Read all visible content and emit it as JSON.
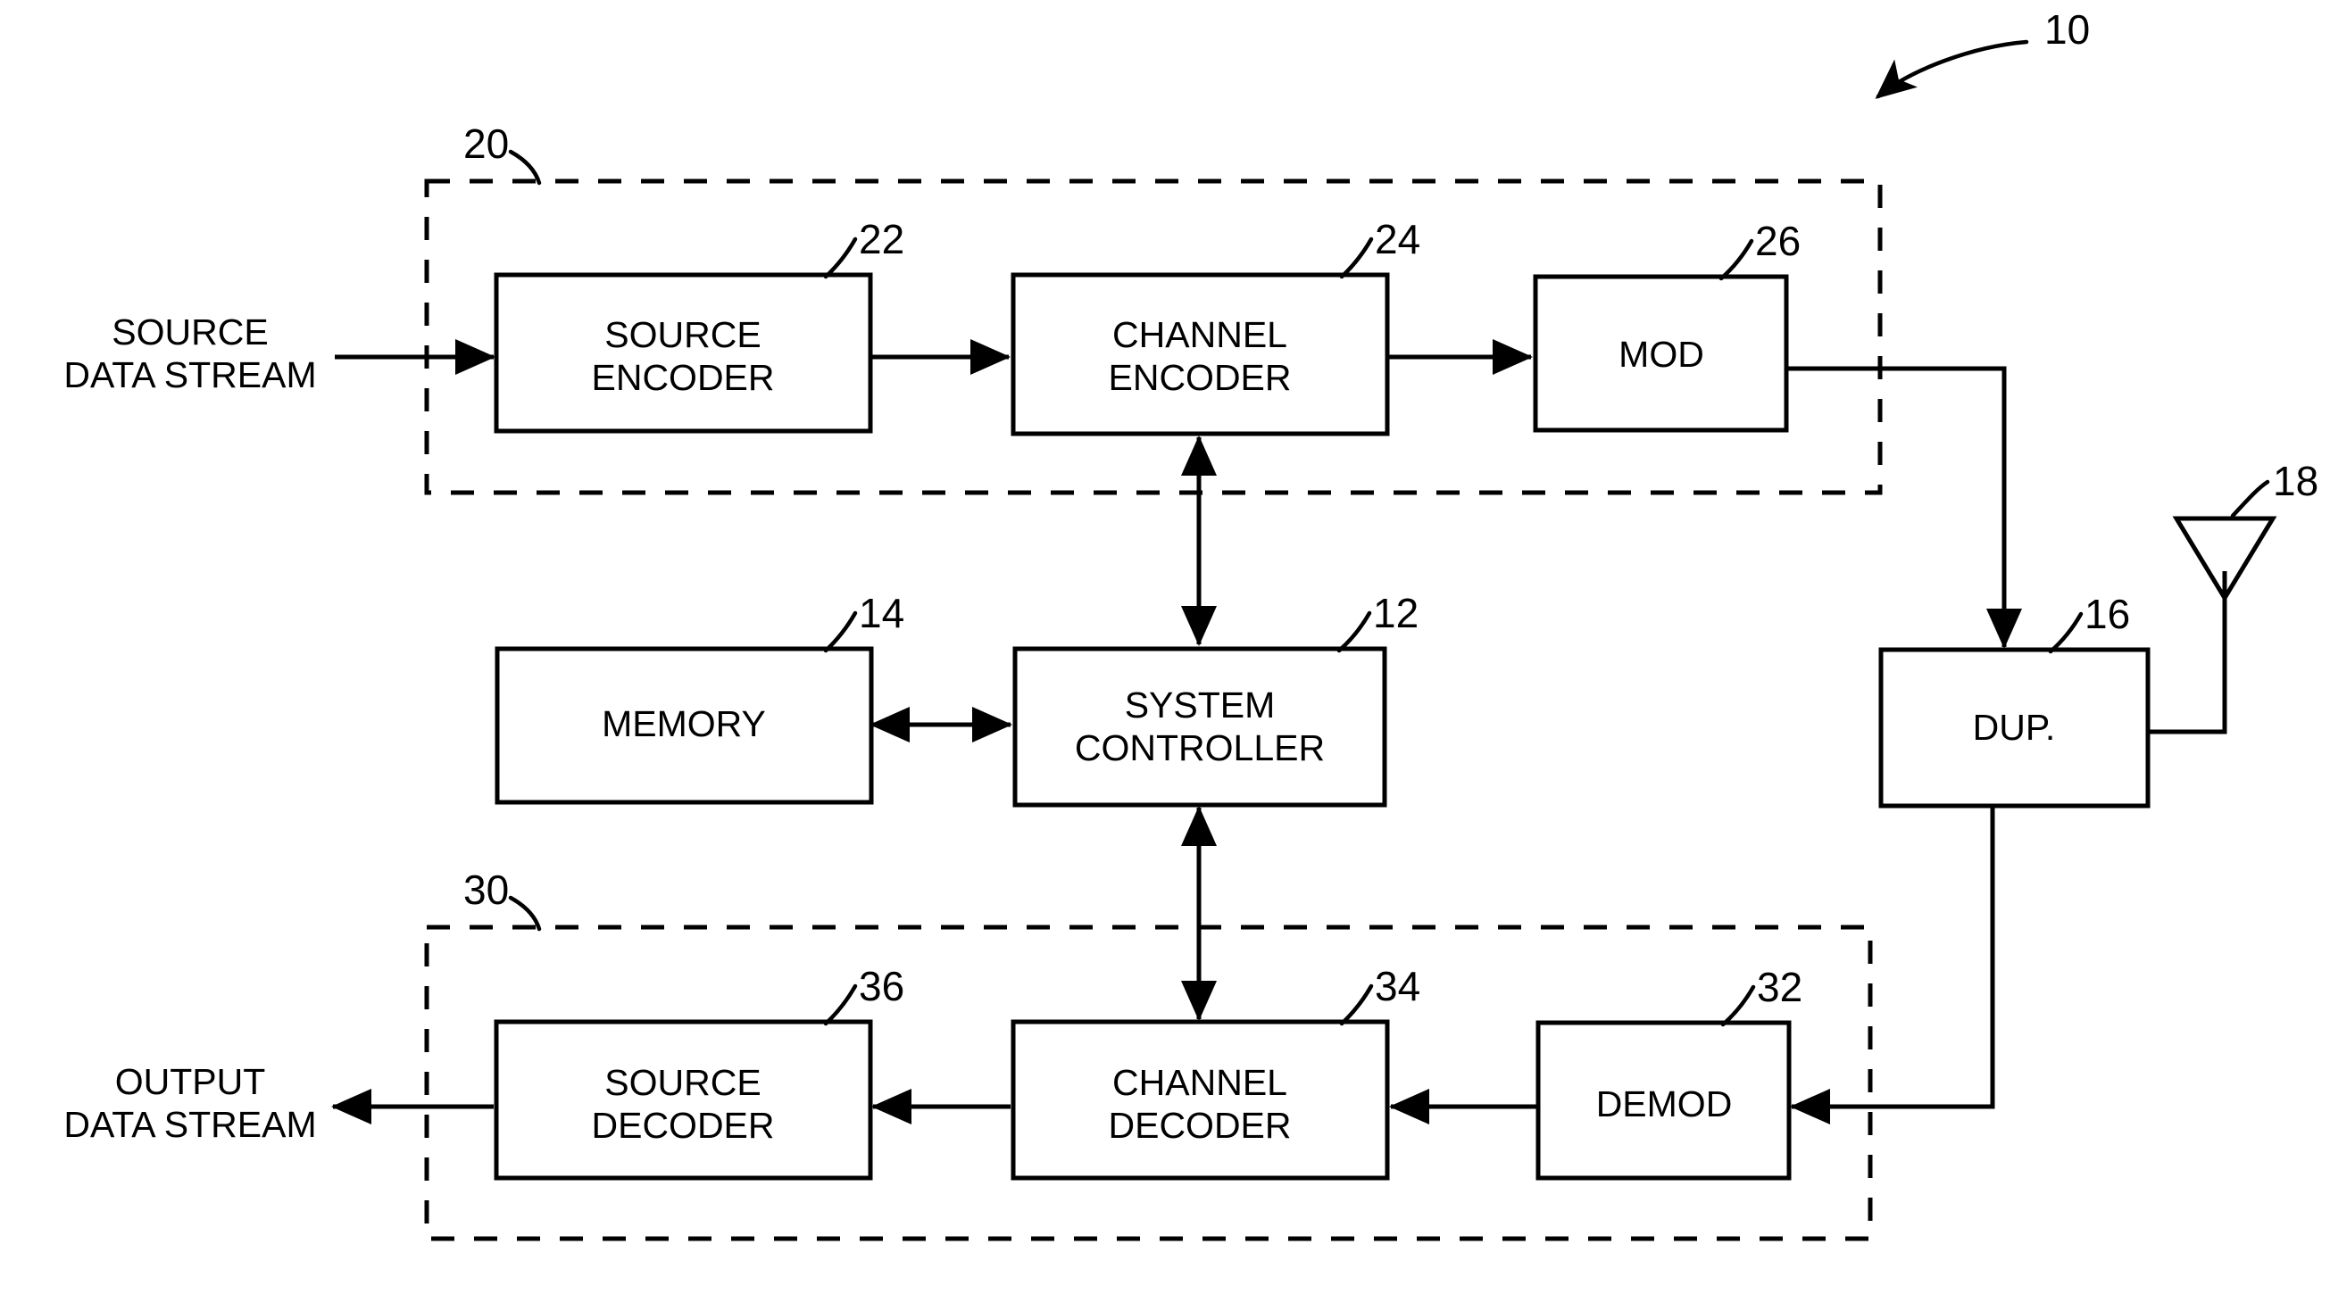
{
  "figure": {
    "title_ref": "10",
    "background_color": "#ffffff",
    "line_color": "#000000"
  },
  "blocks": [
    {
      "id": "source_encoder",
      "label_line1": "SOURCE",
      "label_line2": "ENCODER",
      "ref": "22"
    },
    {
      "id": "channel_encoder",
      "label_line1": "CHANNEL",
      "label_line2": "ENCODER",
      "ref": "24"
    },
    {
      "id": "mod",
      "label_line1": "MOD",
      "label_line2": "",
      "ref": "26"
    },
    {
      "id": "memory",
      "label_line1": "MEMORY",
      "label_line2": "",
      "ref": "14"
    },
    {
      "id": "system_controller",
      "label_line1": "SYSTEM",
      "label_line2": "CONTROLLER",
      "ref": "12"
    },
    {
      "id": "duplexer",
      "label_line1": "DUP.",
      "label_line2": "",
      "ref": "16"
    },
    {
      "id": "source_decoder",
      "label_line1": "SOURCE",
      "label_line2": "DECODER",
      "ref": "36"
    },
    {
      "id": "channel_decoder",
      "label_line1": "CHANNEL",
      "label_line2": "DECODER",
      "ref": "34"
    },
    {
      "id": "demod",
      "label_line1": "DEMOD",
      "label_line2": "",
      "ref": "32"
    }
  ],
  "groups": [
    {
      "id": "transmit_chain",
      "ref": "20"
    },
    {
      "id": "receive_chain",
      "ref": "30"
    }
  ],
  "antenna": {
    "id": "antenna",
    "ref": "18"
  },
  "io_labels": {
    "input_line1": "SOURCE",
    "input_line2": "DATA STREAM",
    "output_line1": "OUTPUT",
    "output_line2": "DATA STREAM"
  }
}
